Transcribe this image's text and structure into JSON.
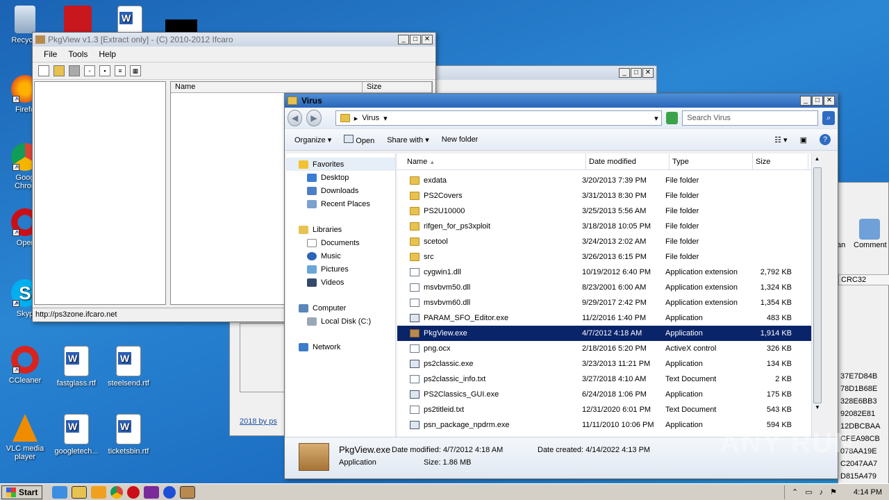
{
  "desktop": {
    "icons_left": [
      "Recycle",
      "Firefo",
      "Goog\nChron",
      "Oper",
      "Skyp",
      "CCleaner",
      "VLC media player"
    ],
    "icons_docs": [
      "fastglass.rtf",
      "steelsend.rtf",
      "googletech...",
      "ticketsbin.rtf"
    ]
  },
  "pkgview": {
    "title": "PkgView v1.3 [Extract only] - (C) 2010-2012 Ifcaro",
    "menu": [
      "File",
      "Tools",
      "Help"
    ],
    "col_name": "Name",
    "col_size": "Size",
    "status": "http://ps3zone.ifcaro.net"
  },
  "background_window": {
    "footer_text": "2018 by ps",
    "right_labels": [
      "an",
      "Comment"
    ],
    "crc_header": "CRC32",
    "crc_values": [
      "37E7D84B",
      "78D1B68E",
      "328E6BB3",
      "92082E81",
      "12DBCBAA",
      "CFEA98CB",
      "078AA19E",
      "C2047AA7",
      "D815A479"
    ]
  },
  "explorer": {
    "title": "Virus",
    "address": "Virus",
    "search_placeholder": "Search Virus",
    "commands": {
      "organize": "Organize",
      "open": "Open",
      "share": "Share with",
      "new_folder": "New folder"
    },
    "nav": {
      "favorites": "Favorites",
      "favorites_items": [
        "Desktop",
        "Downloads",
        "Recent Places"
      ],
      "libraries": "Libraries",
      "libraries_items": [
        "Documents",
        "Music",
        "Pictures",
        "Videos"
      ],
      "computer": "Computer",
      "computer_items": [
        "Local Disk (C:)"
      ],
      "network": "Network"
    },
    "columns": {
      "name": "Name",
      "date": "Date modified",
      "type": "Type",
      "size": "Size"
    },
    "files": [
      {
        "name": "exdata",
        "date": "3/20/2013 7:39 PM",
        "type": "File folder",
        "size": "",
        "kind": "folder"
      },
      {
        "name": "PS2Covers",
        "date": "3/31/2013 8:30 PM",
        "type": "File folder",
        "size": "",
        "kind": "folder"
      },
      {
        "name": "PS2U10000",
        "date": "3/25/2013 5:56 AM",
        "type": "File folder",
        "size": "",
        "kind": "folder"
      },
      {
        "name": "rifgen_for_ps3xploit",
        "date": "3/18/2018 10:05 PM",
        "type": "File folder",
        "size": "",
        "kind": "folder"
      },
      {
        "name": "scetool",
        "date": "3/24/2013 2:02 AM",
        "type": "File folder",
        "size": "",
        "kind": "folder"
      },
      {
        "name": "src",
        "date": "3/26/2013 6:15 PM",
        "type": "File folder",
        "size": "",
        "kind": "folder"
      },
      {
        "name": "cygwin1.dll",
        "date": "10/19/2012 6:40 PM",
        "type": "Application extension",
        "size": "2,792 KB",
        "kind": "file"
      },
      {
        "name": "msvbvm50.dll",
        "date": "8/23/2001 6:00 AM",
        "type": "Application extension",
        "size": "1,324 KB",
        "kind": "file"
      },
      {
        "name": "msvbvm60.dll",
        "date": "9/29/2017 2:42 PM",
        "type": "Application extension",
        "size": "1,354 KB",
        "kind": "file"
      },
      {
        "name": "PARAM_SFO_Editor.exe",
        "date": "11/2/2016 1:40 PM",
        "type": "Application",
        "size": "483 KB",
        "kind": "exe"
      },
      {
        "name": "PkgView.exe",
        "date": "4/7/2012 4:18 AM",
        "type": "Application",
        "size": "1,914 KB",
        "kind": "box",
        "selected": true
      },
      {
        "name": "png.ocx",
        "date": "2/18/2016 5:20 PM",
        "type": "ActiveX control",
        "size": "326 KB",
        "kind": "file"
      },
      {
        "name": "ps2classic.exe",
        "date": "3/23/2013 11:21 PM",
        "type": "Application",
        "size": "134 KB",
        "kind": "exe"
      },
      {
        "name": "ps2classic_info.txt",
        "date": "3/27/2018 4:10 AM",
        "type": "Text Document",
        "size": "2 KB",
        "kind": "file"
      },
      {
        "name": "PS2Classics_GUI.exe",
        "date": "6/24/2018 1:06 PM",
        "type": "Application",
        "size": "175 KB",
        "kind": "exe"
      },
      {
        "name": "ps2titleid.txt",
        "date": "12/31/2020 6:01 PM",
        "type": "Text Document",
        "size": "543 KB",
        "kind": "file"
      },
      {
        "name": "psn_package_npdrm.exe",
        "date": "11/11/2010 10:06 PM",
        "type": "Application",
        "size": "594 KB",
        "kind": "exe"
      }
    ],
    "details": {
      "name": "PkgView.exe",
      "type": "Application",
      "modified_label": "Date modified:",
      "modified": "4/7/2012 4:18 AM",
      "created_label": "Date created:",
      "created": "4/14/2022 4:13 PM",
      "size_label": "Size:",
      "size": "1.86 MB"
    }
  },
  "taskbar": {
    "start": "Start",
    "time": "4:14 PM"
  },
  "watermark": "ANY RUN"
}
